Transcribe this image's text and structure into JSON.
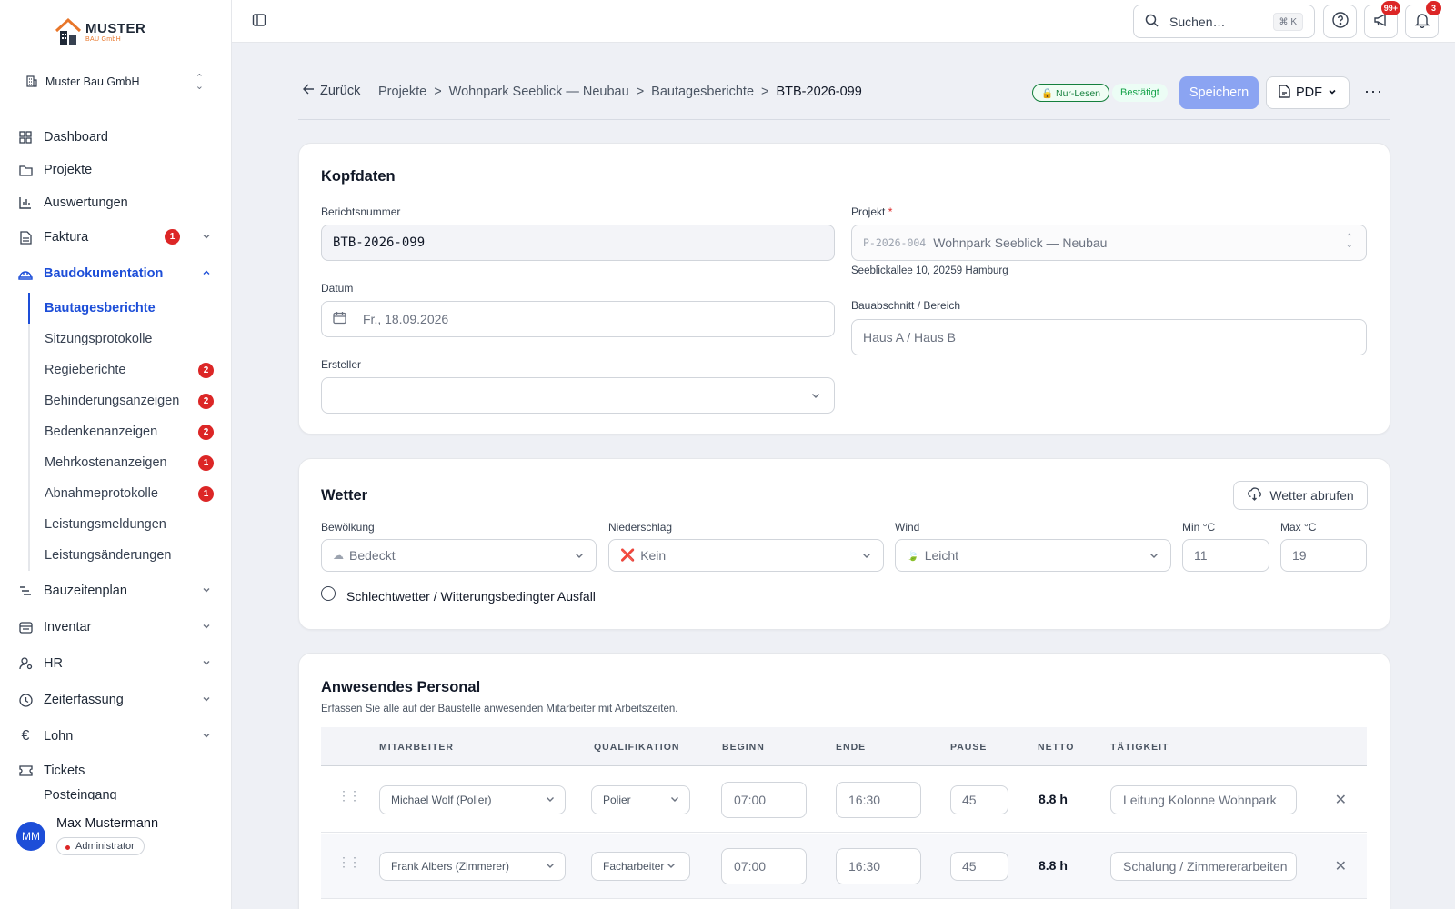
{
  "logo": {
    "line1": "MUSTER",
    "line2": "BAU GmbH"
  },
  "company": {
    "name": "Muster Bau GmbH"
  },
  "nav": {
    "dashboard": "Dashboard",
    "projekte": "Projekte",
    "auswertungen": "Auswertungen",
    "faktura": "Faktura",
    "faktura_badge": "1",
    "baudokumentation": "Baudokumentation",
    "sub": [
      {
        "label": "Bautagesberichte",
        "badge": ""
      },
      {
        "label": "Sitzungsprotokolle",
        "badge": ""
      },
      {
        "label": "Regieberichte",
        "badge": "2"
      },
      {
        "label": "Behinderungsanzeigen",
        "badge": "2"
      },
      {
        "label": "Bedenkenanzeigen",
        "badge": "2"
      },
      {
        "label": "Mehrkostenanzeigen",
        "badge": "1"
      },
      {
        "label": "Abnahmeprotokolle",
        "badge": "1"
      },
      {
        "label": "Leistungsmeldungen",
        "badge": ""
      },
      {
        "label": "Leistungsänderungen",
        "badge": ""
      }
    ],
    "bauzeitenplan": "Bauzeitenplan",
    "inventar": "Inventar",
    "hr": "HR",
    "zeiterfassung": "Zeiterfassung",
    "lohn": "Lohn",
    "tickets": "Tickets",
    "posteingang": "Posteingang"
  },
  "user": {
    "initials": "MM",
    "name": "Max Mustermann",
    "role": "Administrator"
  },
  "topbar": {
    "search_placeholder": "Suchen…",
    "search_kbd": "⌘ K",
    "announce_badge": "99+",
    "bell_badge": "3"
  },
  "header": {
    "back": "Zurück",
    "crumbs": [
      "Projekte",
      "Wohnpark Seeblick — Neubau",
      "Bautagesberichte",
      "BTB-2026-099"
    ],
    "readonly": "🔒 Nur-Lesen",
    "status": "Bestätigt",
    "save": "Speichern",
    "pdf": "PDF"
  },
  "kopf": {
    "title": "Kopfdaten",
    "nr_label": "Berichtsnummer",
    "nr_value": "BTB-2026-099",
    "datum_label": "Datum",
    "datum_value": "Fr., 18.09.2026",
    "ersteller_label": "Ersteller",
    "ersteller_value": "",
    "projekt_label": "Projekt",
    "projekt_code": "P-2026-004",
    "projekt_name": "Wohnpark Seeblick — Neubau",
    "projekt_address": "Seeblickallee 10, 20259 Hamburg",
    "abschnitt_label": "Bauabschnitt / Bereich",
    "abschnitt_placeholder": "Haus A / Haus B"
  },
  "wetter": {
    "title": "Wetter",
    "fetch": "Wetter abrufen",
    "bew_label": "Bewölkung",
    "bew_value": "Bedeckt",
    "bew_icon": "☁",
    "nied_label": "Niederschlag",
    "nied_value": "Kein",
    "nied_icon": "❌",
    "wind_label": "Wind",
    "wind_value": "Leicht",
    "wind_icon": "🍃",
    "min_label": "Min °C",
    "min_value": "11",
    "max_label": "Max °C",
    "max_value": "19",
    "bad_weather": "Schlechtwetter / Witterungsbedingter Ausfall"
  },
  "personal": {
    "title": "Anwesendes Personal",
    "desc": "Erfassen Sie alle auf der Baustelle anwesenden Mitarbeiter mit Arbeitszeiten.",
    "columns": [
      "MITARBEITER",
      "QUALIFIKATION",
      "BEGINN",
      "ENDE",
      "PAUSE",
      "NETTO",
      "TÄTIGKEIT"
    ],
    "rows": [
      {
        "mitarbeiter": "Michael Wolf (Polier)",
        "qualifikation": "Polier",
        "beginn": "07:00",
        "ende": "16:30",
        "pause": "45",
        "netto": "8.8 h",
        "taetigkeit": "Leitung Kolonne Wohnpark"
      },
      {
        "mitarbeiter": "Frank Albers (Zimmerer)",
        "qualifikation": "Facharbeiter",
        "beginn": "07:00",
        "ende": "16:30",
        "pause": "45",
        "netto": "8.8 h",
        "taetigkeit": "Schalung / Zimmererarbeiten"
      }
    ]
  }
}
